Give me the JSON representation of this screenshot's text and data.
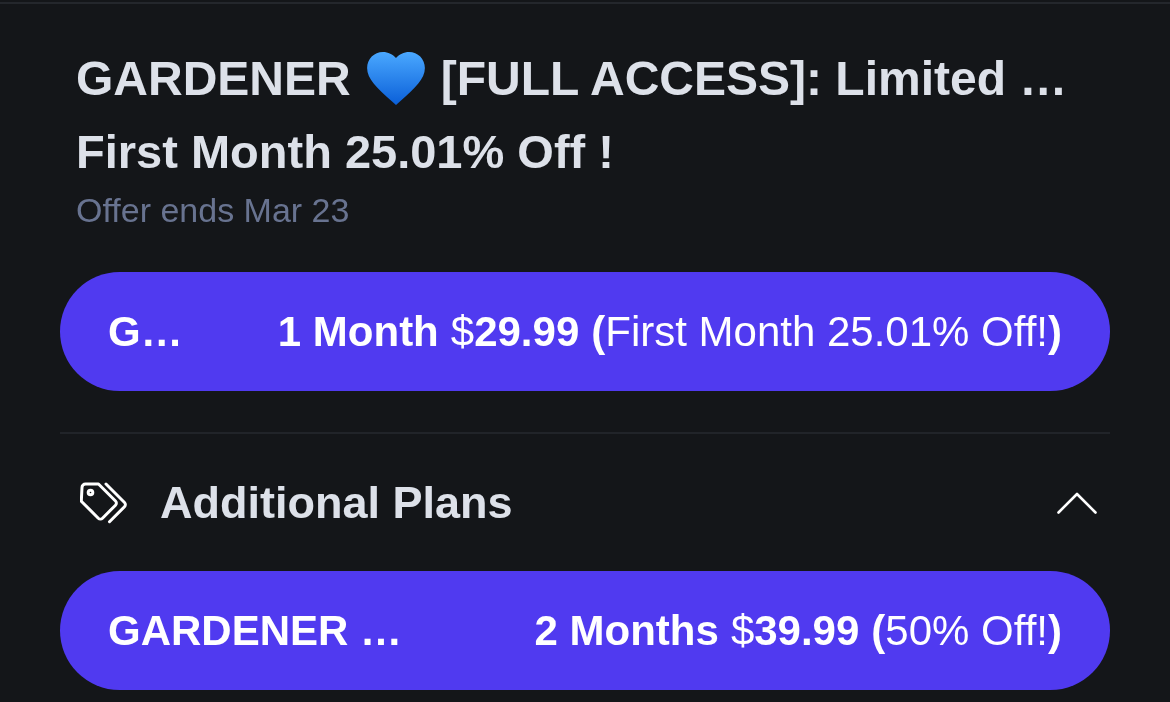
{
  "offer": {
    "title_parts": [
      "GARDENER",
      "[FULL ACCESS]: Limited …"
    ],
    "headline": "First Month 25.01% Off !",
    "expiry": "Offer ends Mar 23"
  },
  "main_plan": {
    "name": "G…",
    "duration": "1 Month",
    "price": "$**29.99**",
    "discount": "**(**First Month 25.01% Off!**)**"
  },
  "additional_plans": {
    "title": "Additional Plans",
    "expanded": true,
    "plans": [
      {
        "name": "GARDENER …",
        "duration": "2 Months",
        "price": "$**39.99**",
        "discount": "**(**50% Off!**)**"
      }
    ]
  }
}
